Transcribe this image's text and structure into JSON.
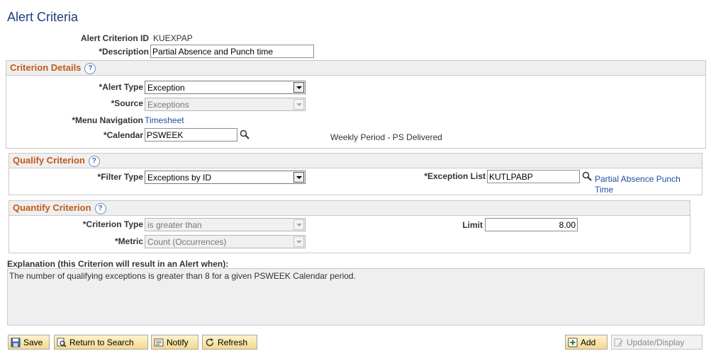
{
  "page": {
    "title": "Alert Criteria"
  },
  "header": {
    "criterion_id_label": "Alert Criterion ID",
    "criterion_id_value": "KUEXPAP",
    "description_label": "*Description",
    "description_value": "Partial Absence and Punch time"
  },
  "criterion_details": {
    "title": "Criterion Details",
    "alert_type_label": "*Alert Type",
    "alert_type_value": "Exception",
    "source_label": "*Source",
    "source_value": "Exceptions",
    "menu_nav_label": "*Menu Navigation",
    "menu_nav_value": "Timesheet",
    "calendar_label": "*Calendar",
    "calendar_value": "PSWEEK",
    "calendar_desc": "Weekly Period - PS Delivered"
  },
  "qualify": {
    "title": "Qualify Criterion",
    "filter_type_label": "*Filter Type",
    "filter_type_value": "Exceptions by ID",
    "exception_list_label": "*Exception List",
    "exception_list_value": "KUTLPABP",
    "exception_link_1": "Partial Absence Punch",
    "exception_link_2": "Time"
  },
  "quantify": {
    "title": "Quantify Criterion",
    "criterion_type_label": "*Criterion Type",
    "criterion_type_value": "is greater than",
    "limit_label": "Limit",
    "limit_value": "8.00",
    "metric_label": "*Metric",
    "metric_value": "Count (Occurrences)"
  },
  "explanation": {
    "label": "Explanation (this Criterion will result in an Alert when):",
    "text": "The number of qualifying exceptions is greater than 8 for a given PSWEEK Calendar period."
  },
  "toolbar": {
    "save": "Save",
    "return_to_search": "Return to Search",
    "notify": "Notify",
    "refresh": "Refresh",
    "add": "Add",
    "update_display": "Update/Display"
  },
  "help_glyph": "?"
}
